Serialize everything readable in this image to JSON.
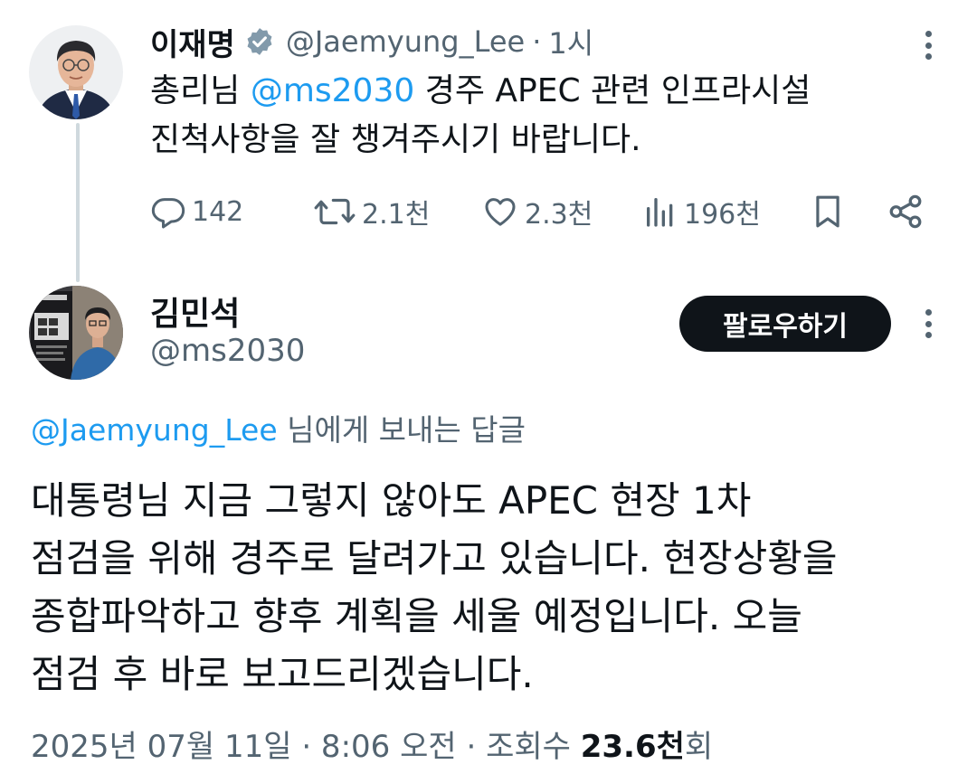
{
  "tweet1": {
    "author_name": "이재명",
    "author_handle": "@Jaemyung_Lee",
    "separator": "·",
    "time": "1시",
    "text_prefix": "총리님 ",
    "mention": "@ms2030",
    "text_line1_rest": " 경주 APEC 관련 인프라시설",
    "text_line2": "진척사항을 잘 챙겨주시기 바랍니다.",
    "stats": {
      "replies": "142",
      "retweets": "2.1천",
      "likes": "2.3천",
      "views": "196천"
    },
    "icons": [
      "verified-badge-icon",
      "reply-icon",
      "retweet-icon",
      "like-icon",
      "views-icon",
      "bookmark-icon",
      "share-icon",
      "more-icon"
    ]
  },
  "tweet2": {
    "author_name": "김민석",
    "author_handle": "@ms2030",
    "follow_label": "팔로우하기",
    "reply_to_handle": "@Jaemyung_Lee",
    "reply_to_suffix": " 님에게 보내는 답글",
    "text_lines": [
      "대통령님 지금 그렇지 않아도 APEC 현장 1차",
      "점검을 위해 경주로 달려가고 있습니다. 현장상황을",
      "종합파악하고 향후 계획을 세울 예정입니다. 오늘",
      "점검 후 바로 보고드리겠습니다."
    ],
    "meta_date": "2025년 07월 11일 · 8:06 오전 · 조회수 ",
    "meta_views": "23.6천",
    "meta_suffix": "회"
  },
  "colors": {
    "link": "#1d9bf0",
    "secondary_text": "#536471",
    "primary_text": "#0f1419",
    "follow_button_bg": "#0f1419",
    "thread_line": "#cfd9de"
  }
}
